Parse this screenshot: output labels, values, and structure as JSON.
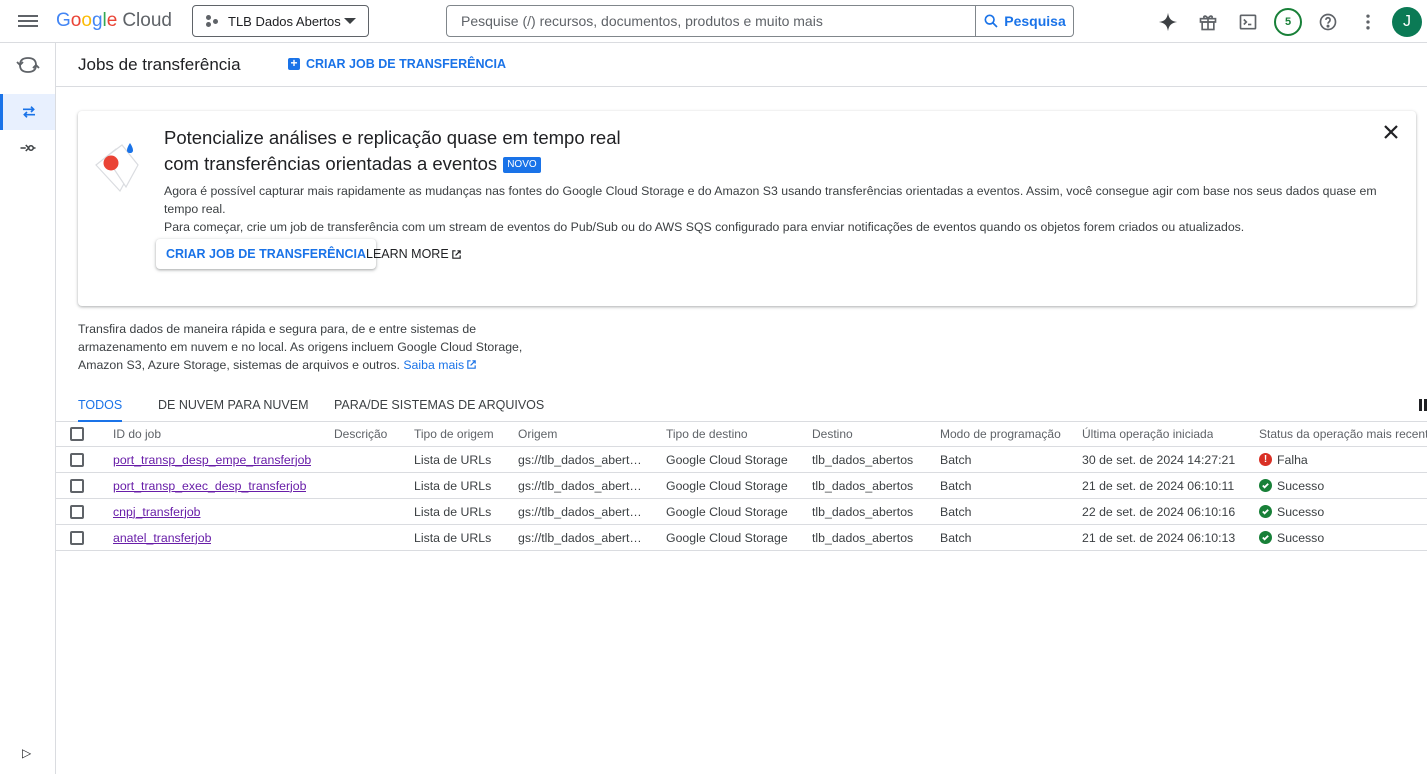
{
  "topbar": {
    "logo_letters": [
      "G",
      "o",
      "o",
      "g",
      "l",
      "e"
    ],
    "logo_cloud": "Cloud",
    "project_name": "TLB Dados Abertos",
    "search_placeholder": "Pesquise (/) recursos, documentos, produtos e muito mais",
    "search_button": "Pesquisa",
    "notification_count": "5",
    "avatar_letter": "J"
  },
  "header": {
    "title": "Jobs de transferência",
    "create_link": "CRIAR JOB DE TRANSFERÊNCIA"
  },
  "banner": {
    "title_line1": "Potencialize análises e replicação quase em tempo real",
    "title_line2": "com transferências orientadas a eventos",
    "badge": "NOVO",
    "desc_line1": "Agora é possível capturar mais rapidamente as mudanças nas fontes do Google Cloud Storage e do Amazon S3 usando transferências orientadas a eventos. Assim, você consegue agir com base nos seus dados quase em tempo real.",
    "desc_line2": "Para começar, crie um job de transferência com um stream de eventos do Pub/Sub ou do AWS SQS configurado para enviar notificações de eventos quando os objetos forem criados ou atualizados.",
    "primary_button": "CRIAR JOB DE TRANSFERÊNCIA",
    "learn_more": "LEARN MORE"
  },
  "intro": {
    "text": "Transfira dados de maneira rápida e segura para, de e entre sistemas de armazenamento em nuvem e no local. As origens incluem Google Cloud Storage, Amazon S3, Azure Storage, sistemas de arquivos e outros.",
    "link": "Saiba mais"
  },
  "tabs": [
    {
      "label": "TODOS",
      "active": true
    },
    {
      "label": "DE NUVEM PARA NUVEM",
      "active": false
    },
    {
      "label": "PARA/DE SISTEMAS DE ARQUIVOS",
      "active": false
    }
  ],
  "table": {
    "columns": [
      "ID do job",
      "Descrição",
      "Tipo de origem",
      "Origem",
      "Tipo de destino",
      "Destino",
      "Modo de programação",
      "Última operação iniciada",
      "Status da operação mais recente"
    ],
    "rows": [
      {
        "id": "port_transp_desp_empe_transferjob",
        "description": "",
        "source_type": "Lista de URLs",
        "source": "gs://tlb_dados_abert…",
        "dest_type": "Google Cloud Storage",
        "dest": "tlb_dados_abertos",
        "mode": "Batch",
        "last_op": "30 de set. de 2024 14:27:21",
        "status": "Falha",
        "status_kind": "error"
      },
      {
        "id": "port_transp_exec_desp_transferjob",
        "description": "",
        "source_type": "Lista de URLs",
        "source": "gs://tlb_dados_abert…",
        "dest_type": "Google Cloud Storage",
        "dest": "tlb_dados_abertos",
        "mode": "Batch",
        "last_op": "21 de set. de 2024 06:10:11",
        "status": "Sucesso",
        "status_kind": "success"
      },
      {
        "id": "cnpj_transferjob",
        "description": "",
        "source_type": "Lista de URLs",
        "source": "gs://tlb_dados_abert…",
        "dest_type": "Google Cloud Storage",
        "dest": "tlb_dados_abertos",
        "mode": "Batch",
        "last_op": "22 de set. de 2024 06:10:16",
        "status": "Sucesso",
        "status_kind": "success"
      },
      {
        "id": "anatel_transferjob",
        "description": "",
        "source_type": "Lista de URLs",
        "source": "gs://tlb_dados_abert…",
        "dest_type": "Google Cloud Storage",
        "dest": "tlb_dados_abertos",
        "mode": "Batch",
        "last_op": "21 de set. de 2024 06:10:13",
        "status": "Sucesso",
        "status_kind": "success"
      }
    ]
  },
  "colors": {
    "accent": "#1a73e8",
    "error": "#d93025",
    "success": "#188038",
    "visited_link": "#681da8"
  }
}
